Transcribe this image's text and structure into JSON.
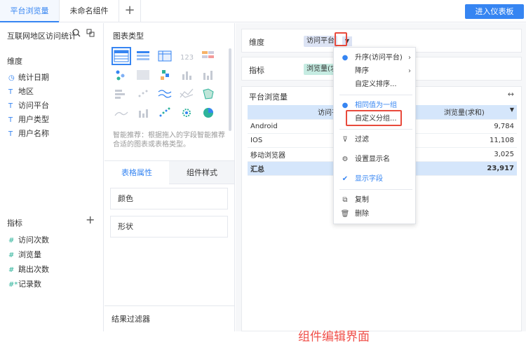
{
  "tabs": {
    "items": [
      {
        "label": "平台浏览量"
      },
      {
        "label": "未命名组件"
      }
    ],
    "add": "+"
  },
  "header": {
    "enter_label": "进入仪表板"
  },
  "left": {
    "dataset_title": "互联网地区访问统计",
    "dimension_title": "维度",
    "dimensions": [
      {
        "icon": "clock-icon",
        "label": "统计日期"
      },
      {
        "icon": "text-T-icon",
        "label": "地区"
      },
      {
        "icon": "text-T-icon",
        "label": "访问平台"
      },
      {
        "icon": "text-T-icon",
        "label": "用户类型"
      },
      {
        "icon": "text-T-icon",
        "label": "用户名称"
      }
    ],
    "measure_title": "指标",
    "measure_add": "+",
    "measures": [
      {
        "icon": "hash-icon",
        "label": "访问次数"
      },
      {
        "icon": "hash-icon",
        "label": "浏览量"
      },
      {
        "icon": "hash-icon",
        "label": "跳出次数"
      },
      {
        "icon": "hash-star-icon",
        "label": "记录数"
      }
    ]
  },
  "middle": {
    "chart_type_title": "图表类型",
    "smart_hint": "智能推荐：根据拖入的字段智能推荐合适的图表或表格类型。",
    "attr_tabs": [
      {
        "label": "表格属性"
      },
      {
        "label": "组件样式"
      }
    ],
    "props": [
      {
        "label": "颜色"
      },
      {
        "label": "形状"
      }
    ],
    "filter_title": "结果过滤器",
    "chart_types": [
      "table",
      "bar-table",
      "cross-table",
      "number-123",
      "heat-table",
      "scatter-dots",
      "blurred",
      "colored-dots",
      "bars-gray",
      "bars-gray-2",
      "bars-h",
      "scatter-small",
      "wave-line",
      "line-x",
      "map-green",
      "area",
      "bars-mixed",
      "dot-scatter",
      "gear-scatter",
      "pie-blue"
    ]
  },
  "right": {
    "dimension_label": "维度",
    "dimension_pill": "访问平台",
    "measure_label": "指标",
    "measure_pill": "浏览量(求",
    "widget_title": "平台浏览量",
    "table": {
      "headers": [
        "访问平台",
        "浏览量(求和)"
      ],
      "rows": [
        [
          "Android",
          "9,784"
        ],
        [
          "IOS",
          "11,108"
        ],
        [
          "移动浏览器",
          "3,025"
        ]
      ],
      "total": [
        "汇总",
        "23,917"
      ]
    },
    "annotation": "组件编辑界面"
  },
  "menu": {
    "items": [
      {
        "label": "升序(访问平台)",
        "has_sub": true,
        "dot": true
      },
      {
        "label": "降序",
        "has_sub": true
      },
      {
        "label": "自定义排序..."
      },
      {
        "label": "相同值为一组",
        "dot": true
      },
      {
        "label": "自定义分组..."
      },
      {
        "label": "过滤",
        "icon": "filter-icon"
      },
      {
        "label": "设置显示名",
        "icon": "gear-icon"
      },
      {
        "label": "显示字段",
        "icon": "check-icon"
      },
      {
        "label": "复制",
        "icon": "copy-icon"
      },
      {
        "label": "删除",
        "icon": "trash-icon"
      }
    ]
  },
  "colors": {
    "accent": "#3685f2",
    "annotation": "#f0504a",
    "highlight_box": "#e84a3c",
    "table_header": "#d5e6fb"
  }
}
